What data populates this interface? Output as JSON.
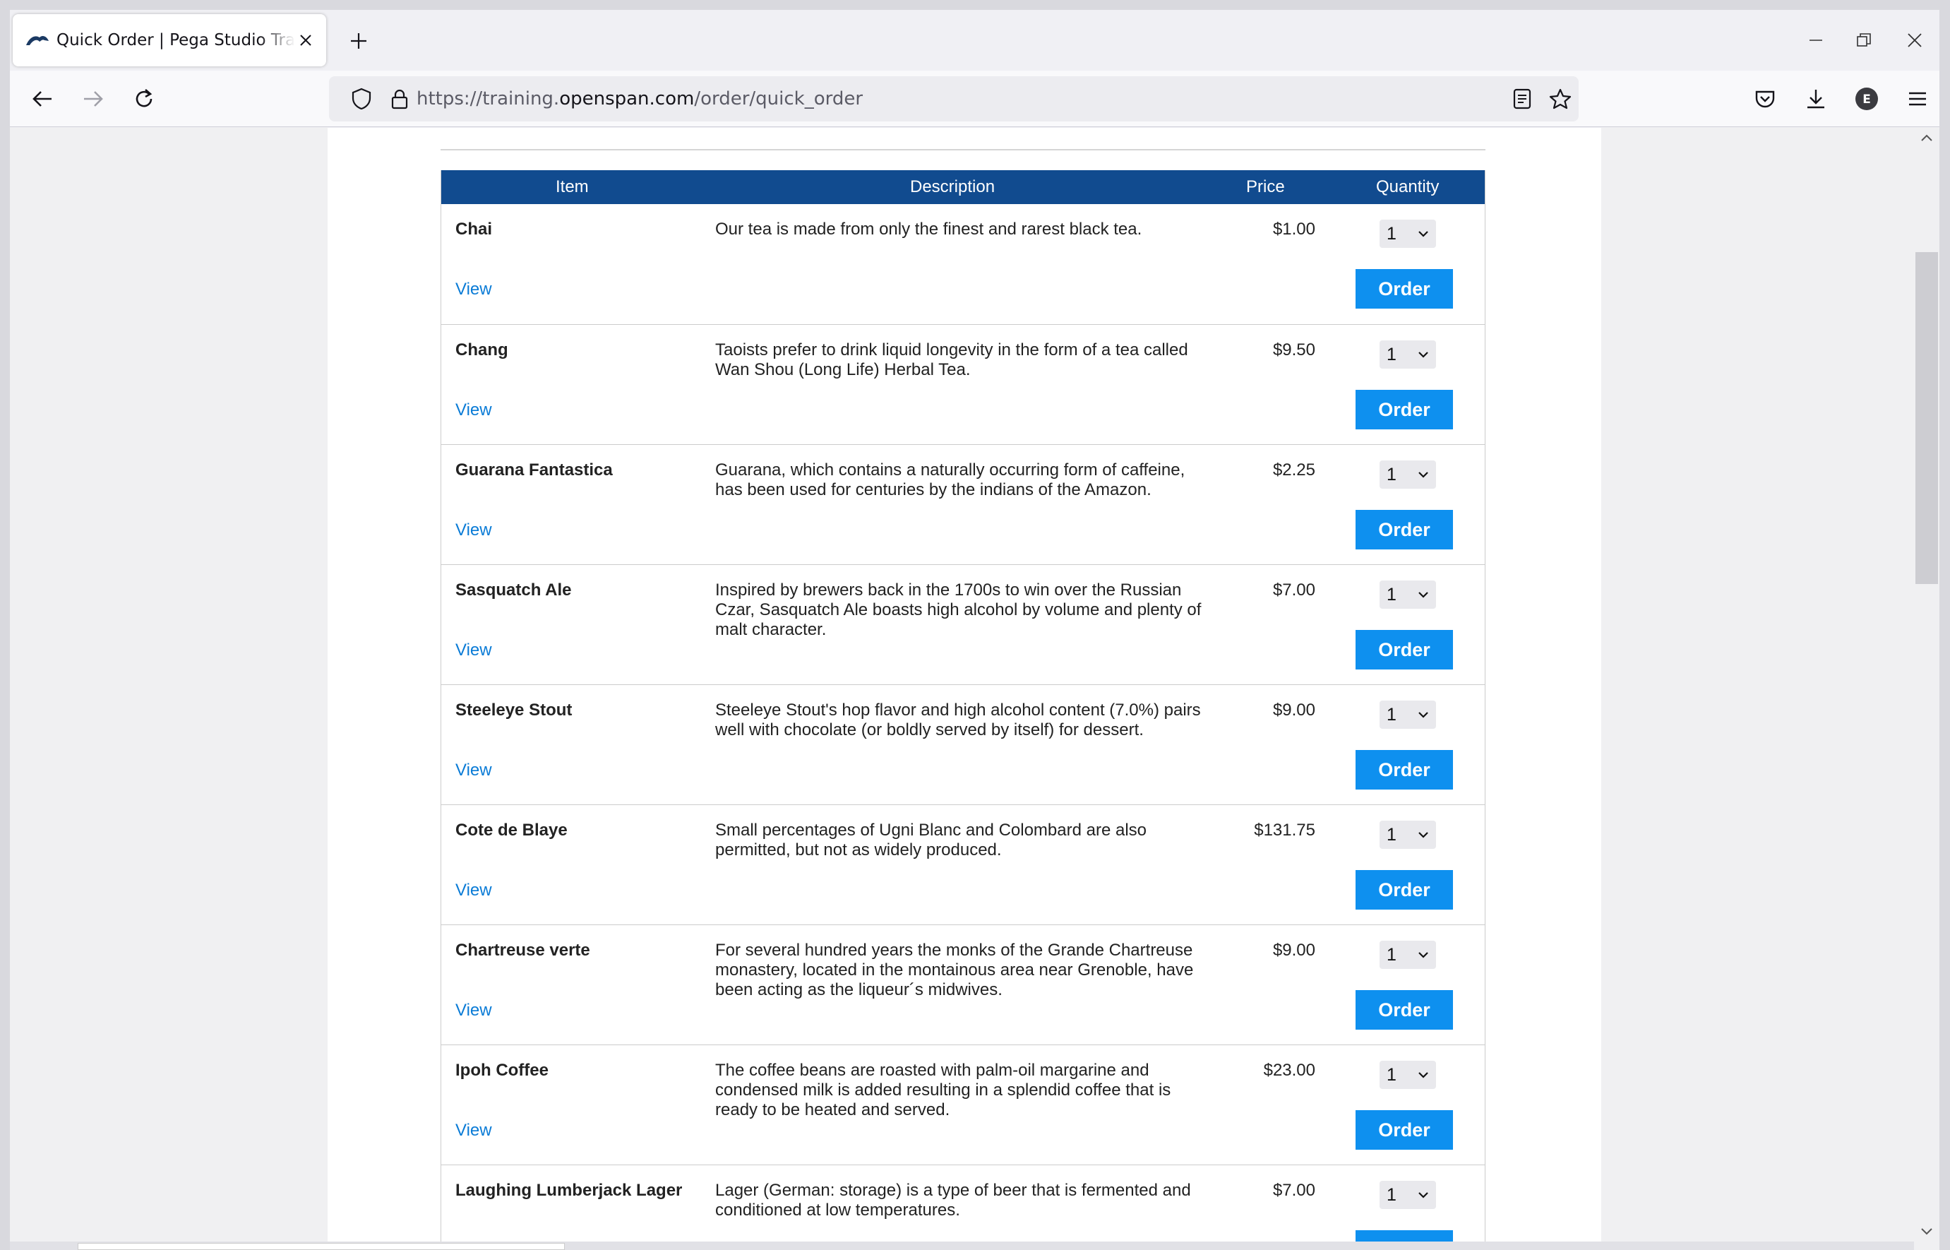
{
  "browser": {
    "tab_title": "Quick Order | Pega Studio Training",
    "url_prefix": "https://training.",
    "url_domain": "openspan.com",
    "url_path": "/order/quick_order",
    "profile_initial": "E"
  },
  "table": {
    "headers": {
      "item": "Item",
      "description": "Description",
      "price": "Price",
      "quantity": "Quantity"
    },
    "view_label": "View",
    "order_label": "Order",
    "rows": [
      {
        "name": "Chai",
        "description": "Our tea is made from only the finest and rarest black tea.",
        "price": "$1.00",
        "qty": "1"
      },
      {
        "name": "Chang",
        "description": "Taoists prefer to drink liquid longevity in the form of a tea called Wan Shou (Long Life) Herbal Tea.",
        "price": "$9.50",
        "qty": "1"
      },
      {
        "name": "Guarana Fantastica",
        "description": "Guarana, which contains a naturally occurring form of caffeine, has been used for centuries by the indians of the Amazon.",
        "price": "$2.25",
        "qty": "1"
      },
      {
        "name": "Sasquatch Ale",
        "description": "Inspired by brewers back in the 1700s to win over the Russian Czar, Sasquatch Ale boasts high alcohol by volume and plenty of malt character.",
        "price": "$7.00",
        "qty": "1"
      },
      {
        "name": "Steeleye Stout",
        "description": "Steeleye Stout's hop flavor and high alcohol content (7.0%) pairs well with chocolate (or boldly served by itself) for dessert.",
        "price": "$9.00",
        "qty": "1"
      },
      {
        "name": "Cote de Blaye",
        "description": "Small percentages of Ugni Blanc and Colombard are also permitted, but not as widely produced.",
        "price": "$131.75",
        "qty": "1"
      },
      {
        "name": "Chartreuse verte",
        "description": "For several hundred years the monks of the Grande Chartreuse monastery, located in the montainous area near Grenoble, have been acting as the liqueur´s midwives.",
        "price": "$9.00",
        "qty": "1"
      },
      {
        "name": "Ipoh Coffee",
        "description": "The coffee beans are roasted with palm-oil margarine and condensed milk is added resulting in a splendid coffee that is ready to be heated and served.",
        "price": "$23.00",
        "qty": "1"
      },
      {
        "name": "Laughing Lumberjack Lager",
        "description": "Lager (German: storage) is a type of beer that is fermented and conditioned at low temperatures.",
        "price": "$7.00",
        "qty": "1"
      }
    ]
  },
  "colors": {
    "header_bg": "#114b8f",
    "order_button": "#0e90ef",
    "link": "#0a7bd6"
  }
}
